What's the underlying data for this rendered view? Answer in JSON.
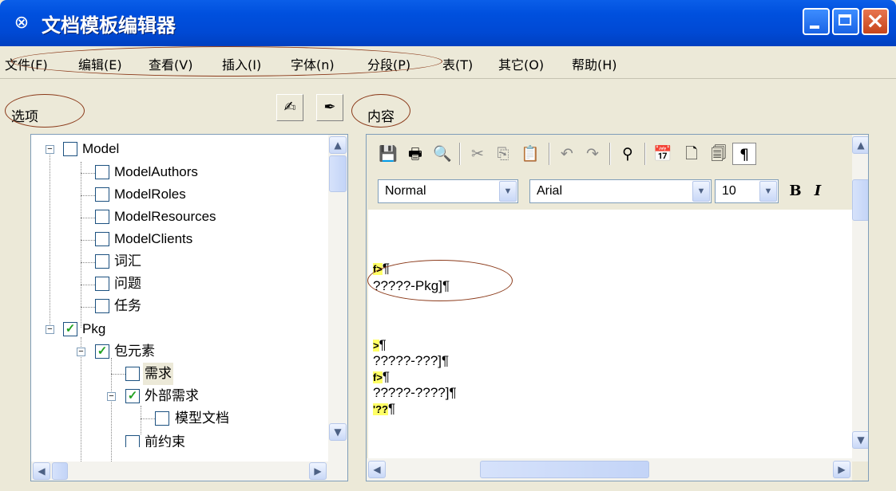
{
  "window": {
    "title": "文档模板编辑器",
    "icon": "app-swirl-icon"
  },
  "menu": [
    "文件(F)",
    "编辑(E)",
    "查看(V)",
    "插入(I)",
    "字体(n)",
    "分段(P)",
    "表(T)",
    "其它(O)",
    "帮助(H)"
  ],
  "options_label": "选项",
  "content_label": "内容",
  "tree": [
    {
      "label": "Model",
      "checked": false,
      "expander": "minus"
    },
    {
      "label": "ModelAuthors",
      "checked": false
    },
    {
      "label": "ModelRoles",
      "checked": false
    },
    {
      "label": "ModelResources",
      "checked": false
    },
    {
      "label": "ModelClients",
      "checked": false
    },
    {
      "label": "词汇",
      "checked": false
    },
    {
      "label": "问题",
      "checked": false
    },
    {
      "label": "任务",
      "checked": false
    },
    {
      "label": "Pkg",
      "checked": true,
      "expander": "minus"
    },
    {
      "label": "包元素",
      "checked": true,
      "expander": "minus"
    },
    {
      "label": "需求",
      "checked": false
    },
    {
      "label": "外部需求",
      "checked": true,
      "expander": "minus"
    },
    {
      "label": "模型文档",
      "checked": false
    },
    {
      "label": "前约束",
      "checked": false
    }
  ],
  "editor": {
    "style_combo": "Normal",
    "font_combo": "Arial",
    "size_combo": "10",
    "bold_label": "B",
    "italic_label": "I",
    "lines": [
      {
        "marker": "f>",
        "text": "¶"
      },
      {
        "marker": "",
        "text": "?????-Pkg]¶"
      },
      {
        "marker": ">",
        "text": "¶"
      },
      {
        "marker": "",
        "text": "?????-???]¶"
      },
      {
        "marker": "f>",
        "text": "¶"
      },
      {
        "marker": "",
        "text": "?????-????]¶"
      },
      {
        "marker": "'??",
        "text": "¶"
      }
    ]
  },
  "colors": {
    "titlebar": "#0050de",
    "annotation": "#8b3a1a",
    "check": "#21a121"
  }
}
